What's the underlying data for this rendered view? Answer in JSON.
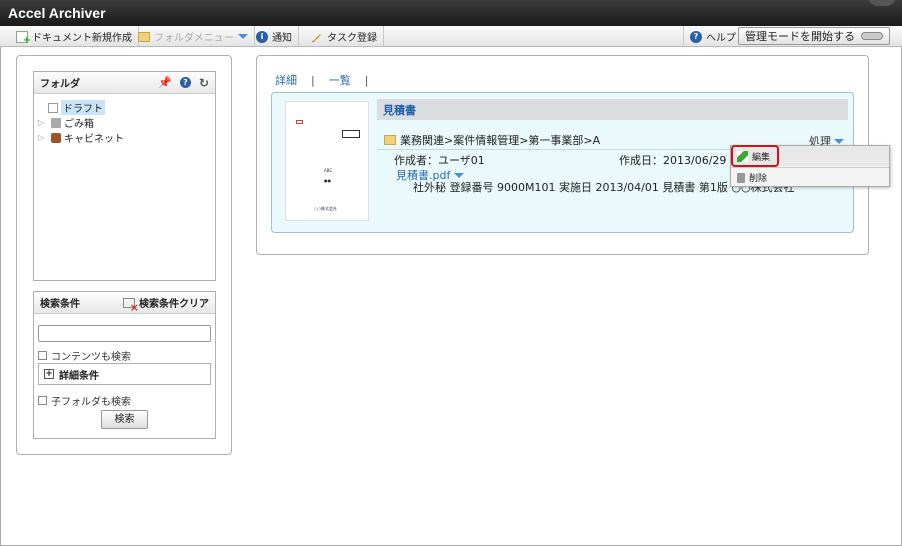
{
  "app": {
    "title": "Accel Archiver"
  },
  "toolbar": {
    "new_doc": "ドキュメント新規作成",
    "folder_menu": "フォルダメニュー",
    "notify": "通知",
    "task": "タスク登録",
    "help": "ヘルプ",
    "mode": "管理モードを開始する"
  },
  "folder_panel": {
    "title": "フォルダ",
    "tree": [
      "ドラフト",
      "ごみ箱",
      "キャビネット"
    ]
  },
  "search_panel": {
    "title": "検索条件",
    "clear": "検索条件クリア",
    "query": "",
    "content_search": "コンテンツも検索",
    "detail": "詳細条件",
    "subfolder": "子フォルダも検索",
    "search_btn": "検索"
  },
  "main": {
    "tabs": [
      "詳細",
      "一覧"
    ],
    "doc": {
      "title": "見積書",
      "path": "業務関連>案件情報管理>第一事業部>A",
      "process": "処理",
      "creator": "作成者：ユーザ01",
      "created": "作成日：2013/06/29",
      "file": "見積書.pdf",
      "description": "社外秘 登録番号 9000M101 実施日 2013/04/01 見積書 第1版 ○○株式会社",
      "thumb_text": [
        "ABC",
        "●●",
        "○○株式会社"
      ]
    }
  },
  "menu": {
    "edit": "編集",
    "delete": "削除"
  }
}
